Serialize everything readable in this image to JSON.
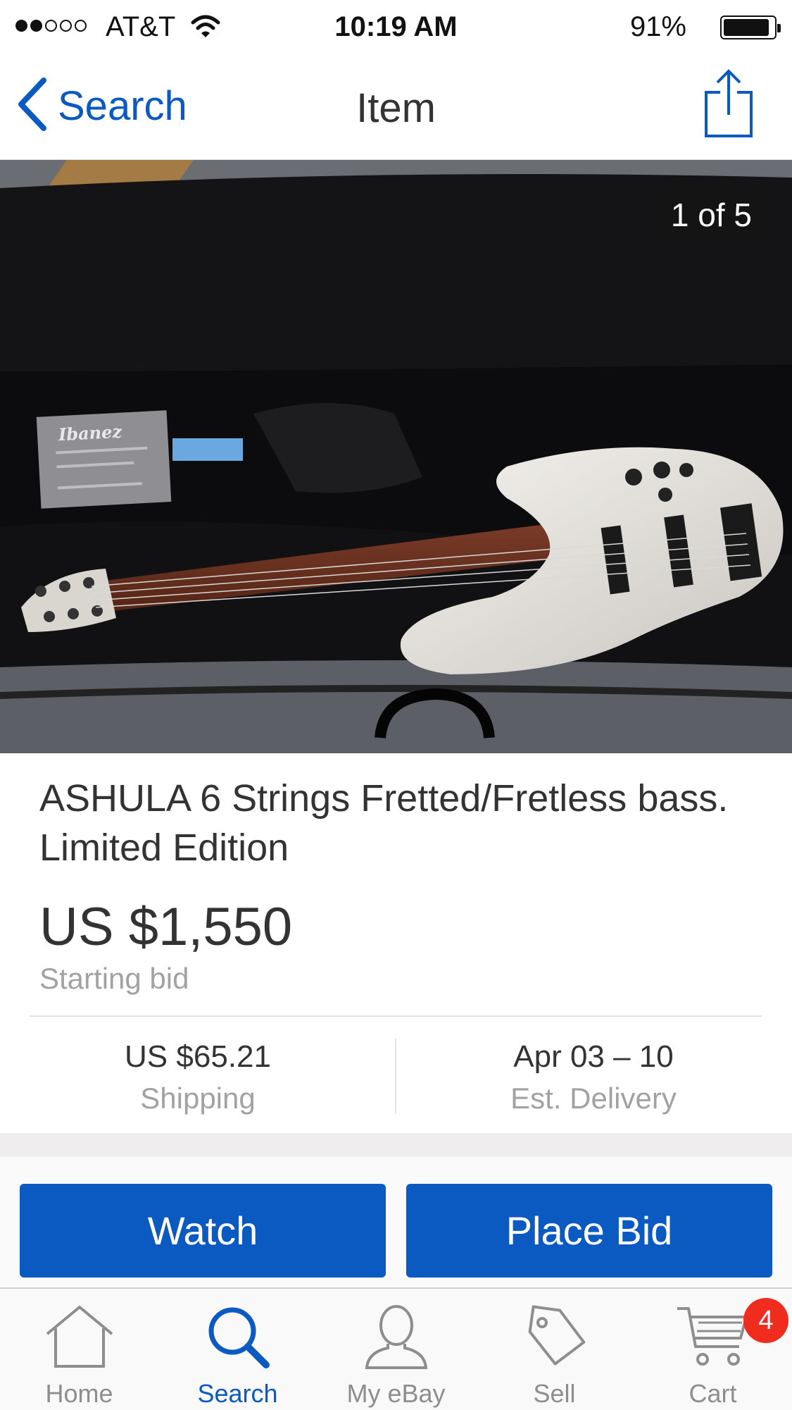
{
  "status_bar": {
    "carrier": "AT&T",
    "time": "10:19 AM",
    "battery": "91%",
    "battery_level": 0.91,
    "signal_bars": 2
  },
  "nav": {
    "back_label": "Search",
    "title": "Item"
  },
  "gallery": {
    "counter": "1 of 5"
  },
  "item": {
    "title": "ASHULA 6 Strings Fretted/Fretless bass. Limited Edition",
    "price": "US $1,550",
    "price_label": "Starting bid",
    "shipping_value": "US $65.21",
    "shipping_label": "Shipping",
    "delivery_value": "Apr 03 – 10",
    "delivery_label": "Est. Delivery"
  },
  "actions": {
    "watch_label": "Watch",
    "bid_label": "Place Bid"
  },
  "tabs": [
    {
      "label": "Home",
      "icon": "home-icon"
    },
    {
      "label": "Search",
      "icon": "search-icon",
      "active": true
    },
    {
      "label": "My eBay",
      "icon": "person-icon"
    },
    {
      "label": "Sell",
      "icon": "tag-icon"
    },
    {
      "label": "Cart",
      "icon": "cart-icon"
    }
  ],
  "cart_badge": "4",
  "colors": {
    "accent": "#0a5ac2",
    "badge": "#f02c1e"
  }
}
